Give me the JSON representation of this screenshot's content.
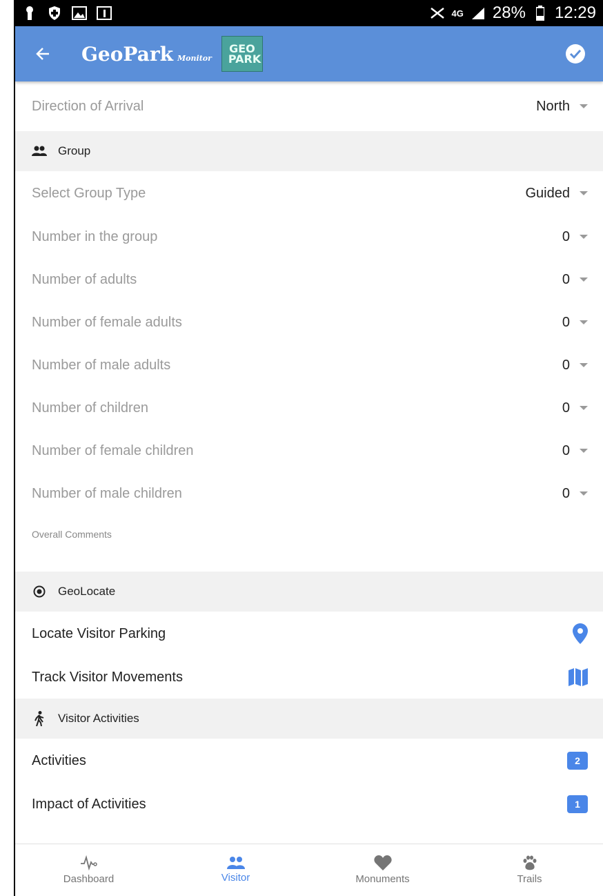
{
  "status_bar": {
    "network": "4G",
    "battery": "28%",
    "time": "12:29"
  },
  "appbar": {
    "title": "GeoPark",
    "subtitle": "Monitor",
    "logo": "GEO PARK",
    "back_icon": "arrow-back-icon",
    "check_icon": "check-circle-icon",
    "color": "#5b8fd9"
  },
  "form": {
    "direction": {
      "label": "Direction of Arrival",
      "value": "North"
    },
    "group_section": {
      "title": "Group",
      "icon": "people-icon"
    },
    "group_type": {
      "label": "Select Group Type",
      "value": "Guided"
    },
    "rows": [
      {
        "label": "Number in the group",
        "value": "0"
      },
      {
        "label": "Number of adults",
        "value": "0"
      },
      {
        "label": "Number of female adults",
        "value": "0"
      },
      {
        "label": "Number of male adults",
        "value": "0"
      },
      {
        "label": "Number of children",
        "value": "0"
      },
      {
        "label": "Number of female children",
        "value": "0"
      },
      {
        "label": "Number of male children",
        "value": "0"
      }
    ],
    "comments_placeholder": "Overall Comments"
  },
  "geolocate": {
    "title": "GeoLocate",
    "icon": "gps-target-icon",
    "items": [
      {
        "label": "Locate Visitor Parking",
        "icon": "location-pin-icon"
      },
      {
        "label": "Track Visitor Movements",
        "icon": "map-icon"
      }
    ]
  },
  "activities": {
    "title": "Visitor Activities",
    "icon": "walking-icon",
    "items": [
      {
        "label": "Activities",
        "count": "2"
      },
      {
        "label": "Impact of Activities",
        "count": "1"
      }
    ]
  },
  "bottom_nav": [
    {
      "label": "Dashboard",
      "icon": "heartbeat-icon",
      "active": false
    },
    {
      "label": "Visitor",
      "icon": "people-icon",
      "active": true
    },
    {
      "label": "Monuments",
      "icon": "heart-icon",
      "active": false
    },
    {
      "label": "Trails",
      "icon": "paw-icon",
      "active": false
    }
  ],
  "colors": {
    "accent": "#4a86e8",
    "section_bg": "#f1f1f1"
  }
}
